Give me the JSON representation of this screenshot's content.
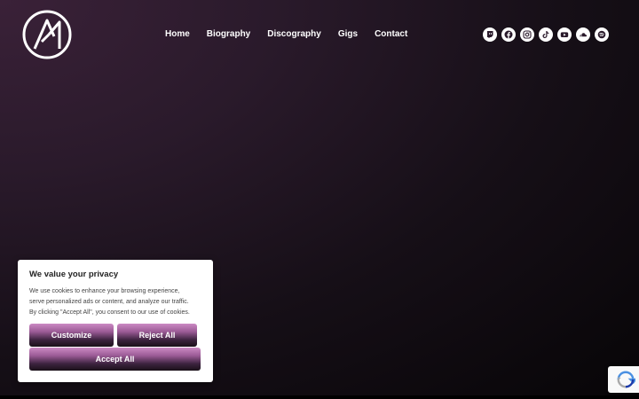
{
  "header": {
    "logo_name": "brand-logo",
    "nav": [
      {
        "label": "Home"
      },
      {
        "label": "Biography"
      },
      {
        "label": "Discography"
      },
      {
        "label": "Gigs"
      },
      {
        "label": "Contact"
      }
    ],
    "socials": [
      {
        "icon": "twitch-icon"
      },
      {
        "icon": "facebook-icon"
      },
      {
        "icon": "instagram-icon"
      },
      {
        "icon": "tiktok-icon"
      },
      {
        "icon": "youtube-icon"
      },
      {
        "icon": "soundcloud-icon"
      },
      {
        "icon": "spotify-icon"
      }
    ]
  },
  "cookie_banner": {
    "title": "We value your privacy",
    "body_line1": "We use cookies to enhance your browsing experience,",
    "body_line2": "serve personalized ads or content, and analyze our traffic.",
    "body_line3": "By clicking \"Accept All\", you consent to our use of cookies.",
    "customize_label": "Customize",
    "reject_label": "Reject All",
    "accept_label": "Accept All"
  },
  "colors": {
    "background": "#1a111b",
    "button_top": "#cc8ac4",
    "button_bottom": "#1a1019"
  }
}
